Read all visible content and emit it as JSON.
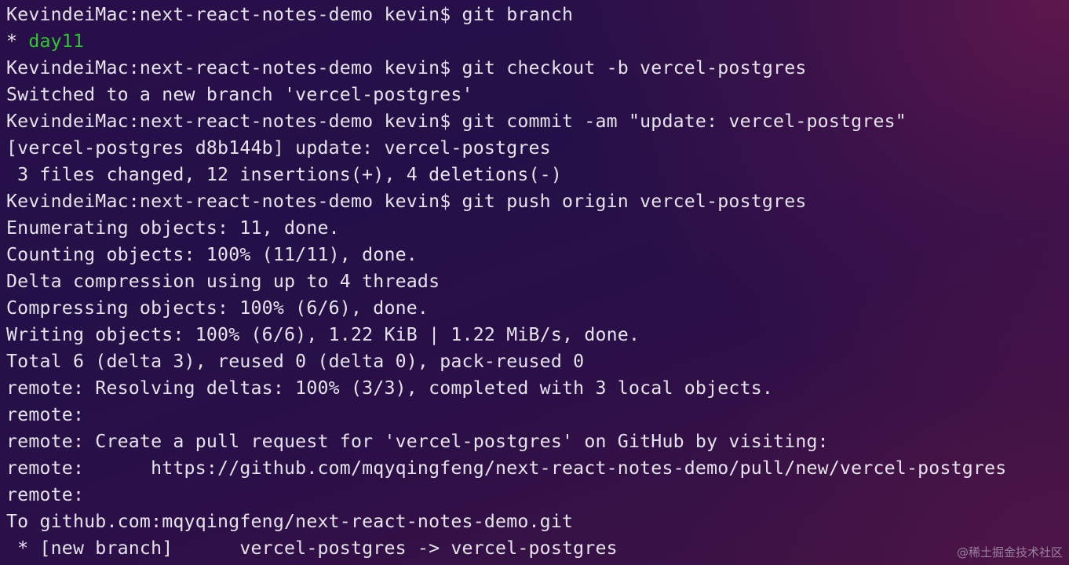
{
  "terminal": {
    "lines": [
      "KevindeiMac:next-react-notes-demo kevin$ git branch",
      "* ",
      "KevindeiMac:next-react-notes-demo kevin$ git checkout -b vercel-postgres",
      "Switched to a new branch 'vercel-postgres'",
      "KevindeiMac:next-react-notes-demo kevin$ git commit -am \"update: vercel-postgres\"",
      "[vercel-postgres d8b144b] update: vercel-postgres",
      " 3 files changed, 12 insertions(+), 4 deletions(-)",
      "KevindeiMac:next-react-notes-demo kevin$ git push origin vercel-postgres",
      "Enumerating objects: 11, done.",
      "Counting objects: 100% (11/11), done.",
      "Delta compression using up to 4 threads",
      "Compressing objects: 100% (6/6), done.",
      "Writing objects: 100% (6/6), 1.22 KiB | 1.22 MiB/s, done.",
      "Total 6 (delta 3), reused 0 (delta 0), pack-reused 0",
      "remote: Resolving deltas: 100% (3/3), completed with 3 local objects.",
      "remote:",
      "remote: Create a pull request for 'vercel-postgres' on GitHub by visiting:",
      "remote:      https://github.com/mqyqingfeng/next-react-notes-demo/pull/new/vercel-postgres",
      "remote:",
      "To github.com:mqyqingfeng/next-react-notes-demo.git",
      " * [new branch]      vercel-postgres -> vercel-postgres"
    ],
    "current_branch": "day11",
    "current_branch_color": "#2ec82e",
    "text_color": "#e6e3ec"
  },
  "watermark": "@稀土掘金技术社区"
}
